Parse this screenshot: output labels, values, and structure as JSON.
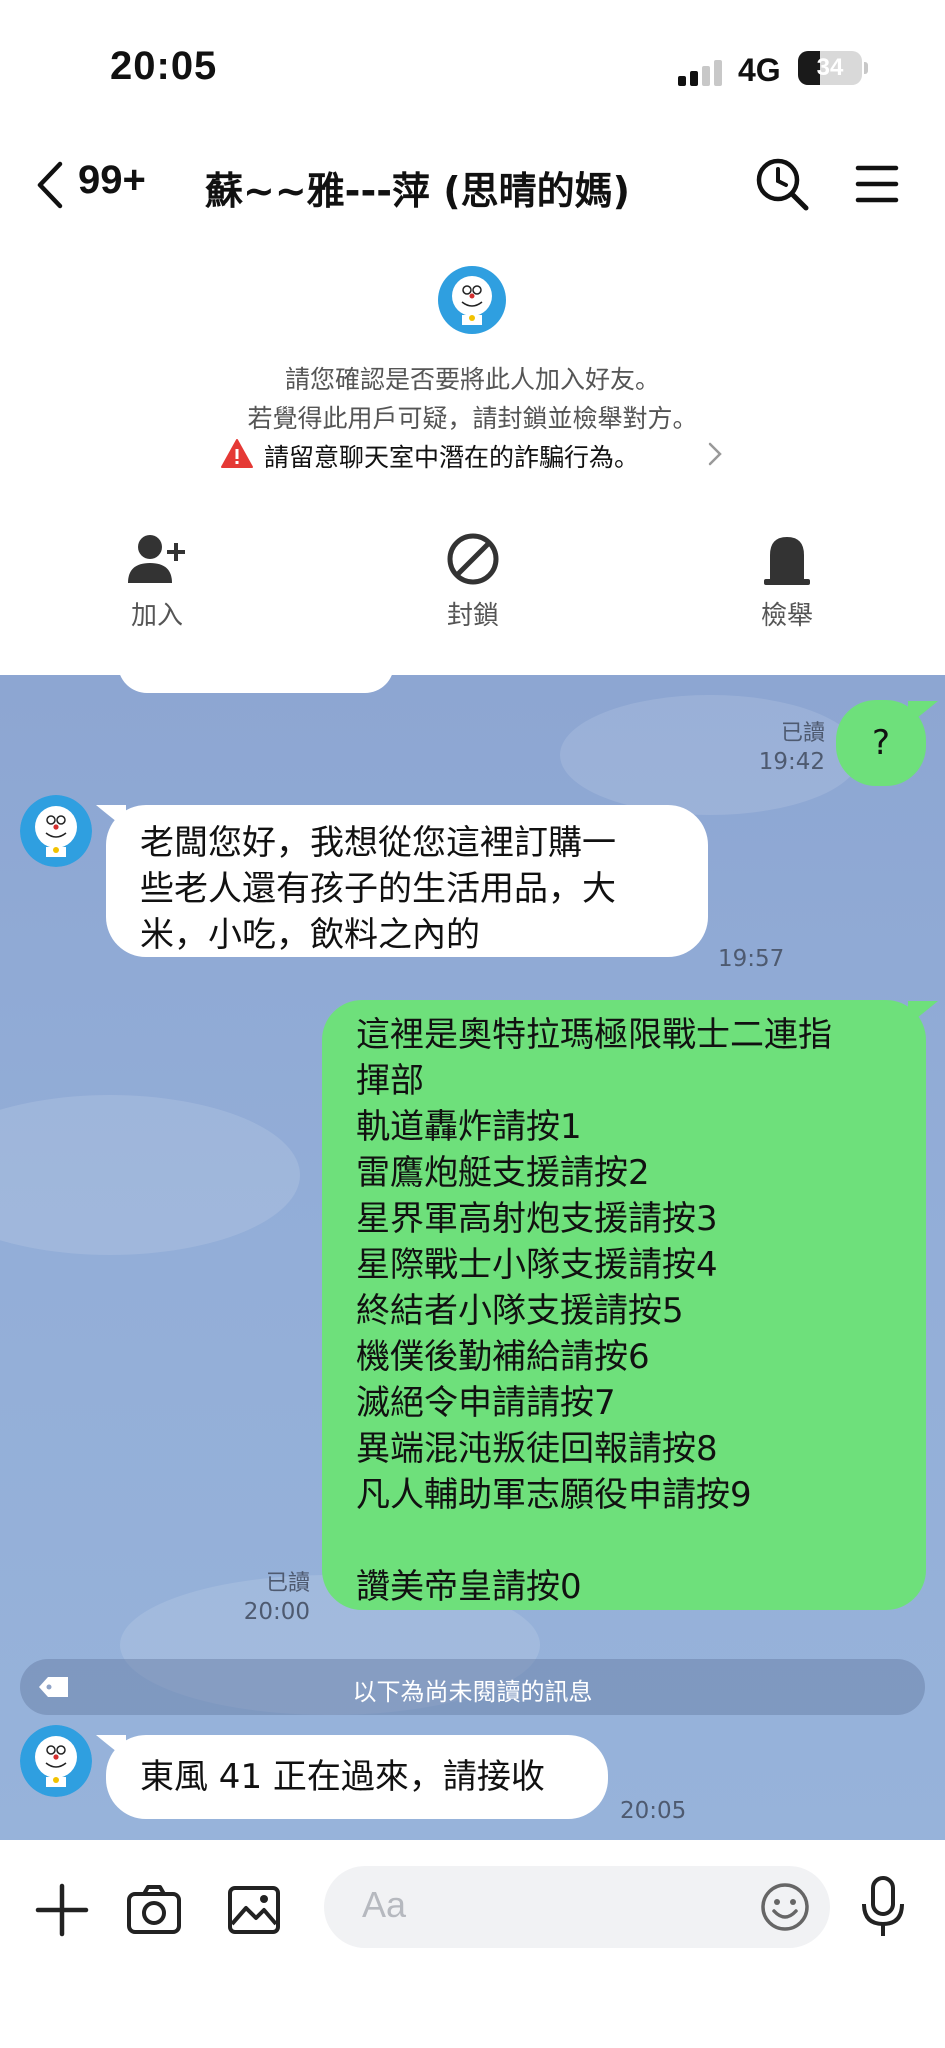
{
  "status_bar": {
    "time": "20:05",
    "network": "4G",
    "battery": "34",
    "battery_level": 0.34
  },
  "header": {
    "unread_count": "99+",
    "title": "蘇~~雅---萍 (思晴的媽)",
    "icons": {
      "back": "chevron-left-icon",
      "search": "search-clock-icon",
      "menu": "hamburger-menu-icon"
    }
  },
  "friend_notice": {
    "line1": "請您確認是否要將此人加入好友。",
    "line2": "若覺得此用戶可疑，請封鎖並檢舉對方。",
    "warning": "請留意聊天室中潛在的詐騙行為。",
    "warning_color": "#e53935",
    "actions": [
      {
        "label": "加入",
        "icon": "add-friend-icon"
      },
      {
        "label": "封鎖",
        "icon": "block-icon"
      },
      {
        "label": "檢舉",
        "icon": "report-icon"
      }
    ]
  },
  "messages": [
    {
      "direction": "out",
      "text": "?",
      "read": "已讀",
      "time": "19:42"
    },
    {
      "direction": "in",
      "lines": [
        "老闆您好，我想從您這裡訂購一",
        "些老人還有孩子的生活用品，大",
        "米，小吃，飲料之內的"
      ],
      "time": "19:57"
    },
    {
      "direction": "out",
      "lines": [
        "這裡是奧特拉瑪極限戰士二連指",
        "揮部",
        "軌道轟炸請按1",
        "雷鷹炮艇支援請按2",
        "星界軍高射炮支援請按3",
        "星際戰士小隊支援請按4",
        "終結者小隊支援請按5",
        "機僕後勤補給請按6",
        "滅絕令申請請按7",
        "異端混沌叛徒回報請按8",
        "凡人輔助軍志願役申請按9",
        "",
        "讚美帝皇請按0"
      ],
      "read": "已讀",
      "time": "20:00"
    },
    {
      "direction": "in",
      "text": "東風 41 正在過來，請接收",
      "time": "20:05"
    }
  ],
  "unread_divider": "以下為尚未閱讀的訊息",
  "composer": {
    "placeholder": "Aa",
    "icons": [
      "plus-icon",
      "camera-icon",
      "image-icon",
      "emoji-icon",
      "microphone-icon"
    ]
  },
  "colors": {
    "chat_background": "#8da6d2",
    "outgoing_bubble": "#6ee07b",
    "incoming_bubble": "#ffffff"
  }
}
